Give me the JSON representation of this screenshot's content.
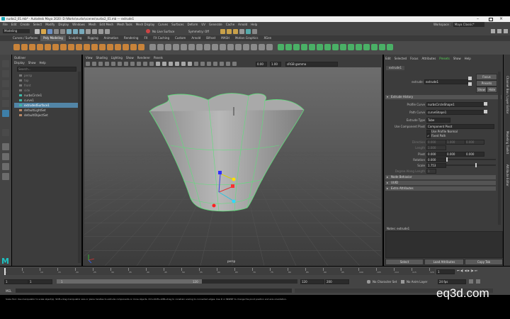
{
  "title": "nurbs2_01.mb* - Autodesk Maya 2020: D:\\Works\\nurbs\\scenes\\nurbs2_01.mb --- extrude1",
  "main_menu": [
    "File",
    "Edit",
    "Create",
    "Select",
    "Modify",
    "Display",
    "Windows",
    "Mesh",
    "Edit Mesh",
    "Mesh Tools",
    "Mesh Display",
    "Curves",
    "Surfaces",
    "Deform",
    "UV",
    "Generate",
    "Cache",
    "Arnold",
    "Help"
  ],
  "workspace": {
    "label": "Workspace :",
    "value": "Maya Classic*"
  },
  "mode": "Modeling",
  "no_live_surface": "No Live Surface",
  "symmetry": "Symmetry: Off",
  "shelf_tabs": [
    "Curves / Surfaces",
    "Poly Modeling",
    "Sculpting",
    "Rigging",
    "Animation",
    "Rendering",
    "FX",
    "FX Caching",
    "Custom",
    "Arnold",
    "Bifrost",
    "MASH",
    "Motion Graphics",
    "XGen"
  ],
  "outliner": {
    "title": "Outliner",
    "menu": [
      "Display",
      "Show",
      "Help"
    ],
    "search_placeholder": "Search...",
    "items": [
      "persp",
      "top",
      "front",
      "side",
      "nurbsCircle1",
      "curve1",
      "extrudedSurface1",
      "defaultLightSet",
      "defaultObjectSet"
    ]
  },
  "viewport": {
    "menu": [
      "View",
      "Shading",
      "Lighting",
      "Show",
      "Renderer",
      "Panels"
    ],
    "val1": "0.00",
    "val2": "1.00",
    "colorspace": "sRGB gamma",
    "camera": "persp"
  },
  "attribute_editor": {
    "tabs": [
      "Edit",
      "Selected",
      "Focus",
      "Attributes",
      "Presets",
      "Show",
      "Help"
    ],
    "node_tab": "extrude1",
    "node_label": "extrude:",
    "node_value": "extrude1",
    "btn_focus": "Focus",
    "btn_presets": "Presets",
    "btn_show": "Show",
    "btn_hide": "Hide",
    "section_history": "Extrude History",
    "profile_curve_label": "Profile Curve",
    "profile_curve_value": "nurbsCircleShape1",
    "path_curve_label": "Path Curve",
    "path_curve_value": "curveShape1",
    "extrude_type_label": "Extrude Type",
    "extrude_type_value": "Tube",
    "use_component_pivot_label": "Use Component Pivot",
    "use_component_pivot_value": "Component Pivot",
    "use_profile_normal": "Use Profile Normal",
    "fixed_path": "Fixed Path",
    "direction_label": "Direction",
    "direction_values": [
      "0.000",
      "1.000",
      "0.000"
    ],
    "length_label": "Length",
    "length_value": "1.000",
    "pivot_label": "Pivot",
    "pivot_values": [
      "0.000",
      "0.000",
      "0.000"
    ],
    "rotation_label": "Rotation",
    "rotation_value": "0.000",
    "rotation_fraction": 0,
    "scale_label": "Scale",
    "scale_value": "1.753",
    "scale_fraction": 0.6,
    "degree_label": "Degree Along Length",
    "degree_value": "1",
    "sections": [
      "Node Behavior",
      "UUID",
      "Extra Attributes"
    ],
    "notes_label": "Notes: extrude1",
    "btn_select": "Select",
    "btn_load": "Load Attributes",
    "btn_copy": "Copy Tab"
  },
  "side_tabs": [
    "Channel Box / Layer Editor",
    "Modeling Toolkit",
    "Attribute Editor"
  ],
  "timeline": {
    "ticks": [
      "1",
      "5",
      "10",
      "15",
      "20",
      "25",
      "30",
      "35",
      "40",
      "45",
      "50",
      "55",
      "60",
      "65",
      "70",
      "75",
      "80",
      "85",
      "90",
      "95",
      "100",
      "105",
      "110",
      "115",
      "120"
    ],
    "current_frame": "1"
  },
  "range": {
    "start": "1",
    "sub_start": "1",
    "mid": "1",
    "sub_end": "120",
    "end": "120",
    "end2": "200"
  },
  "status": {
    "character": "No Character Set",
    "anim_layer": "No Anim Layer",
    "fps": "24 fps"
  },
  "mel_label": "MEL",
  "help_line": "Scale Tool: Use manipulator to scale object(s). Shift+drag manipulator axis or plane handles to extrude components or clone objects. Ctrl+Shift+LMB+drag to constrain scaling to connected edges. Use D or INSERT to change the pivot position and axis orientation.",
  "watermark": "eq3d.com",
  "colors": {
    "wire": "#5de07a",
    "accent": "#00a8c6",
    "surface": "#9a9a9a"
  }
}
